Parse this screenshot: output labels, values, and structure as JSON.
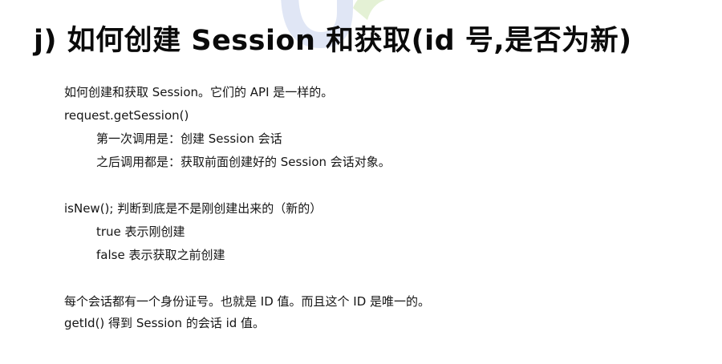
{
  "slide": {
    "title": "j) 如何创建 Session 和获取(id 号,是否为新)"
  },
  "body": {
    "lines": [
      "如何创建和获取 Session。它们的 API 是一样的。",
      "request.getSession()",
      "第一次调用是：创建 Session 会话",
      "之后调用都是：获取前面创建好的 Session 会话对象。",
      "isNew(); 判断到底是不是刚创建出来的（新的）",
      "true  表示刚创建",
      "false  表示获取之前创建",
      "每个会话都有一个身份证号。也就是 ID 值。而且这个 ID 是唯一的。",
      "getId() 得到 Session 的会话 id 值。"
    ]
  },
  "watermark": {
    "colors": [
      "#c7d3ee",
      "#cfe7b4",
      "#f3e39f"
    ]
  }
}
